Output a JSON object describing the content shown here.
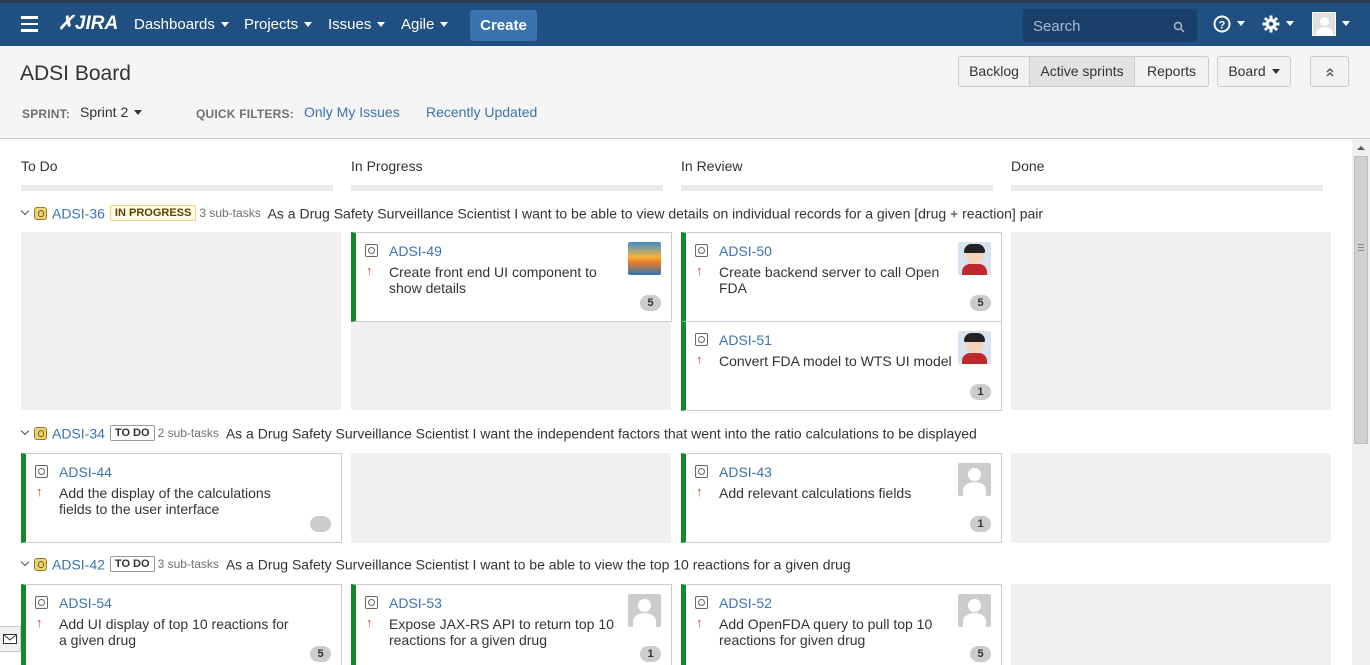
{
  "topnav": {
    "logo": "JIRA",
    "menus": [
      "Dashboards",
      "Projects",
      "Issues",
      "Agile"
    ],
    "create_label": "Create",
    "search_placeholder": "Search"
  },
  "header": {
    "title": "ADSI Board",
    "view_buttons": [
      "Backlog",
      "Active sprints",
      "Reports"
    ],
    "active_view": "Active sprints",
    "board_button": "Board",
    "sprint_label": "SPRINT:",
    "sprint_value": "Sprint 2",
    "quick_filters_label": "QUICK FILTERS:",
    "quick_filters": [
      "Only My Issues",
      "Recently Updated"
    ]
  },
  "columns": [
    "To Do",
    "In Progress",
    "In Review",
    "Done"
  ],
  "swimlanes": [
    {
      "key": "ADSI-36",
      "status": "IN PROGRESS",
      "subtasks": "3 sub-tasks",
      "summary": "As a Drug Safety Surveillance Scientist I want to be able to view details on individual records for a given [drug + reaction] pair",
      "cards": [
        {
          "key": "ADSI-49",
          "summary_lines": [
            "Create front end UI component to",
            "show details"
          ],
          "estimate": "5",
          "avatar": "sunset"
        },
        {
          "key": "ADSI-50",
          "summary_lines": [
            "Create backend server to call Open",
            "FDA"
          ],
          "estimate": "5",
          "avatar": "person"
        },
        {
          "key": "ADSI-51",
          "summary_lines": [
            "Convert FDA model to WTS UI model"
          ],
          "estimate": "1",
          "avatar": "person"
        }
      ]
    },
    {
      "key": "ADSI-34",
      "status": "TO DO",
      "subtasks": "2 sub-tasks",
      "summary": "As a Drug Safety Surveillance Scientist I want the independent factors that went into the ratio calculations to be displayed",
      "cards": [
        {
          "key": "ADSI-44",
          "summary_lines": [
            "Add the display of the calculations",
            "fields to the user interface"
          ],
          "estimate": "",
          "avatar": "none"
        },
        {
          "key": "ADSI-43",
          "summary_lines": [
            "Add relevant calculations fields"
          ],
          "estimate": "1",
          "avatar": "generic"
        }
      ]
    },
    {
      "key": "ADSI-42",
      "status": "TO DO",
      "subtasks": "3 sub-tasks",
      "summary": "As a Drug Safety Surveillance Scientist I want to be able to view the top 10 reactions for a given drug",
      "cards": [
        {
          "key": "ADSI-54",
          "summary_lines": [
            "Add UI display of top 10 reactions for",
            "a given drug"
          ],
          "estimate": "5",
          "avatar": "none"
        },
        {
          "key": "ADSI-53",
          "summary_lines": [
            "Expose JAX-RS API to return top 10",
            "reactions for a given drug"
          ],
          "estimate": "1",
          "avatar": "generic"
        },
        {
          "key": "ADSI-52",
          "summary_lines": [
            "Add OpenFDA query to pull top 10",
            "reactions for given drug"
          ],
          "estimate": "5",
          "avatar": "generic"
        }
      ]
    }
  ],
  "icons": {
    "menu": "hamburger-icon",
    "help": "help-icon",
    "settings": "gear-icon",
    "user": "user-avatar-icon",
    "search": "search-icon",
    "collapse": "double-chevron-up-icon",
    "feedback": "envelope-icon"
  },
  "colors": {
    "nav": "#205081",
    "link": "#3b73af",
    "card_border": "#14892c",
    "priority": "#d04437"
  }
}
